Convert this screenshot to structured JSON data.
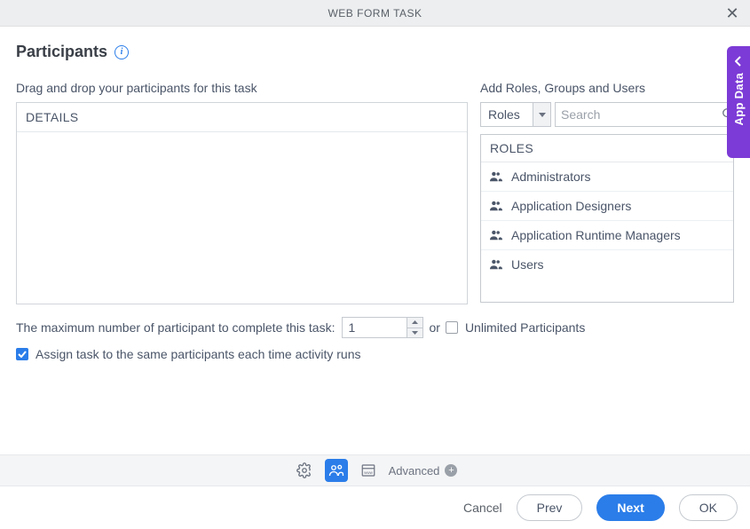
{
  "header": {
    "title": "WEB FORM TASK"
  },
  "page": {
    "heading": "Participants"
  },
  "left_panel": {
    "label": "Drag and drop your participants for this task",
    "dropzone_title": "DETAILS"
  },
  "right_panel": {
    "label": "Add Roles, Groups and Users",
    "select_value": "Roles",
    "search_placeholder": "Search",
    "list_header": "ROLES",
    "roles": [
      {
        "name": "Administrators"
      },
      {
        "name": "Application Designers"
      },
      {
        "name": "Application Runtime Managers"
      },
      {
        "name": "Users"
      }
    ]
  },
  "options": {
    "max_label": "The maximum number of participant to complete this task:",
    "max_value": "1",
    "or_label": "or",
    "unlimited_label": "Unlimited Participants",
    "unlimited_checked": false,
    "assign_label": "Assign task to the same participants each time activity runs",
    "assign_checked": true
  },
  "toolbar": {
    "advanced_label": "Advanced"
  },
  "footer": {
    "cancel": "Cancel",
    "prev": "Prev",
    "next": "Next",
    "ok": "OK"
  },
  "side_tab": {
    "label": "App Data"
  }
}
